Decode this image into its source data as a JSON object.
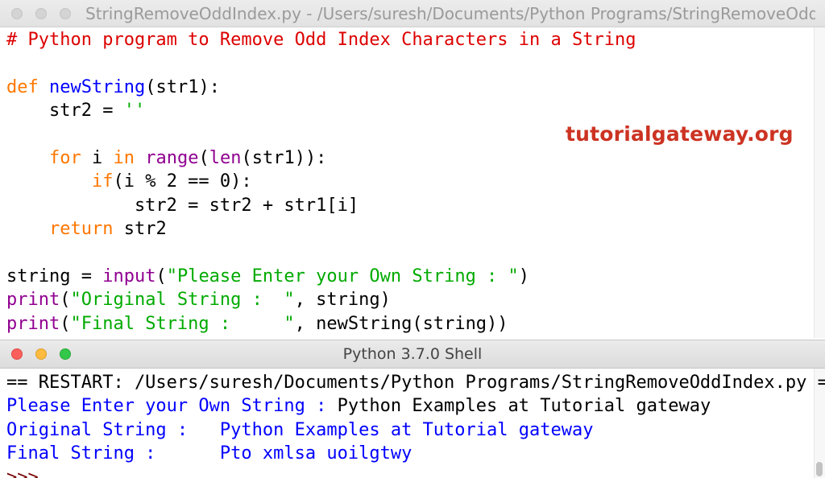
{
  "editor": {
    "title": "StringRemoveOddIndex.py - /Users/suresh/Documents/Python Programs/StringRemoveOddInd...",
    "watermark": "tutorialgateway.org",
    "lines": [
      [
        {
          "t": "# Python program to Remove Odd Index Characters in a String",
          "c": "comment"
        }
      ],
      [],
      [
        {
          "t": "def",
          "c": "keyword"
        },
        {
          "t": " "
        },
        {
          "t": "newString",
          "c": "defname"
        },
        {
          "t": "(str1):"
        }
      ],
      [
        {
          "t": "    str2 = "
        },
        {
          "t": "''",
          "c": "string"
        }
      ],
      [],
      [
        {
          "t": "    "
        },
        {
          "t": "for",
          "c": "keyword"
        },
        {
          "t": " i "
        },
        {
          "t": "in",
          "c": "keyword"
        },
        {
          "t": " "
        },
        {
          "t": "range",
          "c": "builtin"
        },
        {
          "t": "("
        },
        {
          "t": "len",
          "c": "builtin"
        },
        {
          "t": "(str1)):"
        }
      ],
      [
        {
          "t": "        "
        },
        {
          "t": "if",
          "c": "keyword"
        },
        {
          "t": "(i % 2 == 0):"
        }
      ],
      [
        {
          "t": "            str2 = str2 + str1[i]"
        }
      ],
      [
        {
          "t": "    "
        },
        {
          "t": "return",
          "c": "keyword"
        },
        {
          "t": " str2"
        }
      ],
      [],
      [
        {
          "t": "string = "
        },
        {
          "t": "input",
          "c": "builtin"
        },
        {
          "t": "("
        },
        {
          "t": "\"Please Enter your Own String : \"",
          "c": "string"
        },
        {
          "t": ")"
        }
      ],
      [
        {
          "t": "print",
          "c": "builtin"
        },
        {
          "t": "("
        },
        {
          "t": "\"Original String :  \"",
          "c": "string"
        },
        {
          "t": ", string)"
        }
      ],
      [
        {
          "t": "print",
          "c": "builtin"
        },
        {
          "t": "("
        },
        {
          "t": "\"Final String :     \"",
          "c": "string"
        },
        {
          "t": ", newString(string))"
        }
      ]
    ]
  },
  "shell": {
    "title": "Python 3.7.0 Shell",
    "lines": [
      [
        {
          "t": "== RESTART: /Users/suresh/Documents/Python Programs/StringRemoveOddIndex.py =="
        }
      ],
      [
        {
          "t": "Please Enter your Own String : ",
          "c": "stdout"
        },
        {
          "t": "Python Examples at Tutorial gateway"
        }
      ],
      [
        {
          "t": "Original String :   Python Examples at Tutorial gateway",
          "c": "stdout"
        }
      ],
      [
        {
          "t": "Final String :      Pto xmlsa uoilgtwy",
          "c": "stdout"
        }
      ],
      [
        {
          "t": ">>>",
          "c": "prompt"
        }
      ]
    ]
  },
  "colors": {
    "comment": "#dd0000",
    "keyword": "#ff7700",
    "defname": "#0000ff",
    "builtin": "#900090",
    "string": "#00aa00",
    "stdout": "#0000ff",
    "prompt": "#770000",
    "watermark": "#cc3322"
  },
  "icons": {
    "editor_window_controls": [
      "close-icon",
      "minimize-icon",
      "zoom-icon"
    ],
    "shell_window_controls": [
      "close-icon",
      "minimize-icon",
      "zoom-icon"
    ]
  }
}
